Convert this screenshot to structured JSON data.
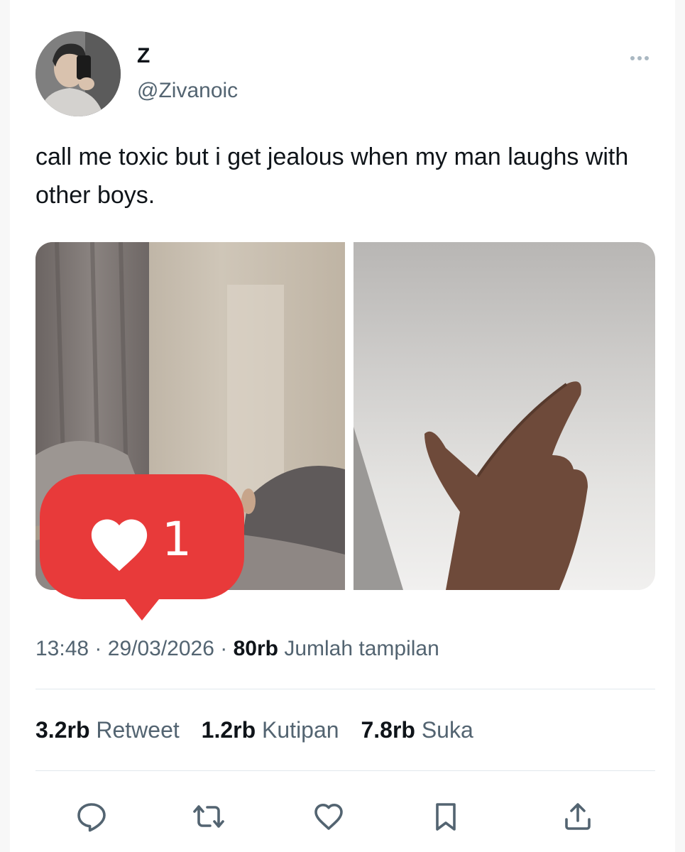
{
  "tweet": {
    "display_name": "Z",
    "handle": "@Zivanoic",
    "text": "call me toxic but i get jealous when my man laughs with other boys.",
    "time": "13:48",
    "date": "29/03/2026",
    "views_count": "80rb",
    "views_label": "Jumlah tampilan",
    "separator": "·"
  },
  "stats": {
    "retweets": {
      "count": "3.2rb",
      "label": "Retweet"
    },
    "quotes": {
      "count": "1.2rb",
      "label": "Kutipan"
    },
    "likes": {
      "count": "7.8rb",
      "label": "Suka"
    }
  },
  "like_notification": {
    "count": "1"
  },
  "colors": {
    "notification_red": "#e83a3a",
    "secondary_text": "#536471",
    "divider": "#e1e8ed"
  },
  "icons": {
    "more": "more-horizontal-icon",
    "reply": "reply-icon",
    "retweet": "retweet-icon",
    "like": "heart-icon",
    "bookmark": "bookmark-icon",
    "share": "share-icon"
  }
}
